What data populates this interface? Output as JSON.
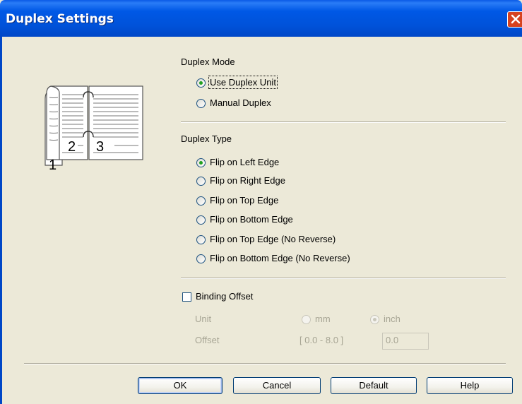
{
  "window": {
    "title": "Duplex Settings"
  },
  "duplex_mode": {
    "heading": "Duplex Mode",
    "options": [
      {
        "label": "Use Duplex Unit",
        "checked": true
      },
      {
        "label": "Manual Duplex",
        "checked": false
      }
    ]
  },
  "duplex_type": {
    "heading": "Duplex Type",
    "options": [
      {
        "label": "Flip on Left Edge",
        "checked": true
      },
      {
        "label": "Flip on Right Edge",
        "checked": false
      },
      {
        "label": "Flip on Top Edge",
        "checked": false
      },
      {
        "label": "Flip on Bottom Edge",
        "checked": false
      },
      {
        "label": "Flip on Top Edge (No Reverse)",
        "checked": false
      },
      {
        "label": "Flip on Bottom Edge (No Reverse)",
        "checked": false
      }
    ]
  },
  "binding_offset": {
    "label": "Binding Offset",
    "checked": false,
    "unit_label": "Unit",
    "unit_mm": "mm",
    "unit_inch": "inch",
    "offset_label": "Offset",
    "offset_range": "[ 0.0 - 8.0 ]",
    "offset_value": "0.0"
  },
  "illustration": {
    "page_numbers": [
      "1",
      "2",
      "3"
    ]
  },
  "buttons": {
    "ok": "OK",
    "cancel": "Cancel",
    "default": "Default",
    "help": "Help"
  },
  "colors": {
    "titlebar": "#0054e3",
    "dialog_bg": "#ece9d8",
    "radio_dot": "#21a121"
  }
}
